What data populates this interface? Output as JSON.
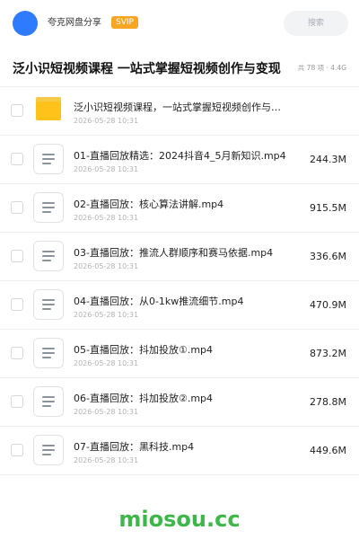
{
  "header": {
    "user_name": "夸克网盘分享",
    "badge": "SVIP",
    "search_label": "搜索"
  },
  "share": {
    "title": "泛小识短视频课程 一站式掌握短视频创作与变现",
    "meta": "共 78 项 · 4.4G"
  },
  "files": [
    {
      "name": "泛小识短视频课程，一站式掌握短视频创作与变现",
      "date": "2026-05-28 10:31",
      "size": "",
      "type": "folder",
      "icon": "folder-icon"
    },
    {
      "name": "01-直播回放精选：2024抖音4_5月新知识.mp4",
      "date": "2026-05-28 10:31",
      "size": "244.3M",
      "type": "file",
      "icon": "document-icon"
    },
    {
      "name": "02-直播回放：核心算法讲解.mp4",
      "date": "2026-05-28 10:31",
      "size": "915.5M",
      "type": "file",
      "icon": "document-icon"
    },
    {
      "name": "03-直播回放：推流人群顺序和赛马依据.mp4",
      "date": "2026-05-28 10:31",
      "size": "336.6M",
      "type": "file",
      "icon": "document-icon"
    },
    {
      "name": "04-直播回放：从0-1kw推流细节.mp4",
      "date": "2026-05-28 10:31",
      "size": "470.9M",
      "type": "file",
      "icon": "document-icon"
    },
    {
      "name": "05-直播回放：抖加投放①.mp4",
      "date": "2026-05-28 10:31",
      "size": "873.2M",
      "type": "file",
      "icon": "document-icon"
    },
    {
      "name": "06-直播回放：抖加投放②.mp4",
      "date": "2026-05-28 10:31",
      "size": "278.8M",
      "type": "file",
      "icon": "document-icon"
    },
    {
      "name": "07-直播回放：黑科技.mp4",
      "date": "2026-05-28 10:31",
      "size": "449.6M",
      "type": "file",
      "icon": "document-icon"
    }
  ],
  "watermark": "miosou.cc",
  "colors": {
    "accent": "#2f7bff",
    "badge": "#f6a623",
    "folder": "#ffc21a",
    "watermark": "#3fb64a"
  }
}
